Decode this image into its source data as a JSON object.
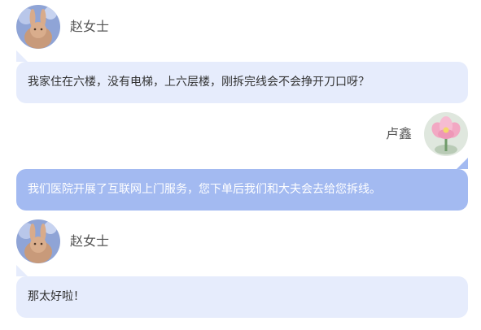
{
  "colors": {
    "incoming_bubble": "#e6ecfc",
    "outgoing_bubble": "#a3baf1",
    "incoming_text": "#333333",
    "outgoing_text": "#ffffff",
    "name_text": "#555555"
  },
  "messages": [
    {
      "sender": "赵女士",
      "direction": "incoming",
      "avatar": "rabbit-avatar",
      "text": "我家住在六楼，没有电梯，上六层楼，刚拆完线会不会挣开刀口呀？"
    },
    {
      "sender": "卢鑫",
      "direction": "outgoing",
      "avatar": "lotus-flower-avatar",
      "text": "我们医院开展了互联网上门服务，您下单后我们和大夫会去给您拆线。"
    },
    {
      "sender": "赵女士",
      "direction": "incoming",
      "avatar": "rabbit-avatar",
      "text": "那太好啦！"
    }
  ]
}
